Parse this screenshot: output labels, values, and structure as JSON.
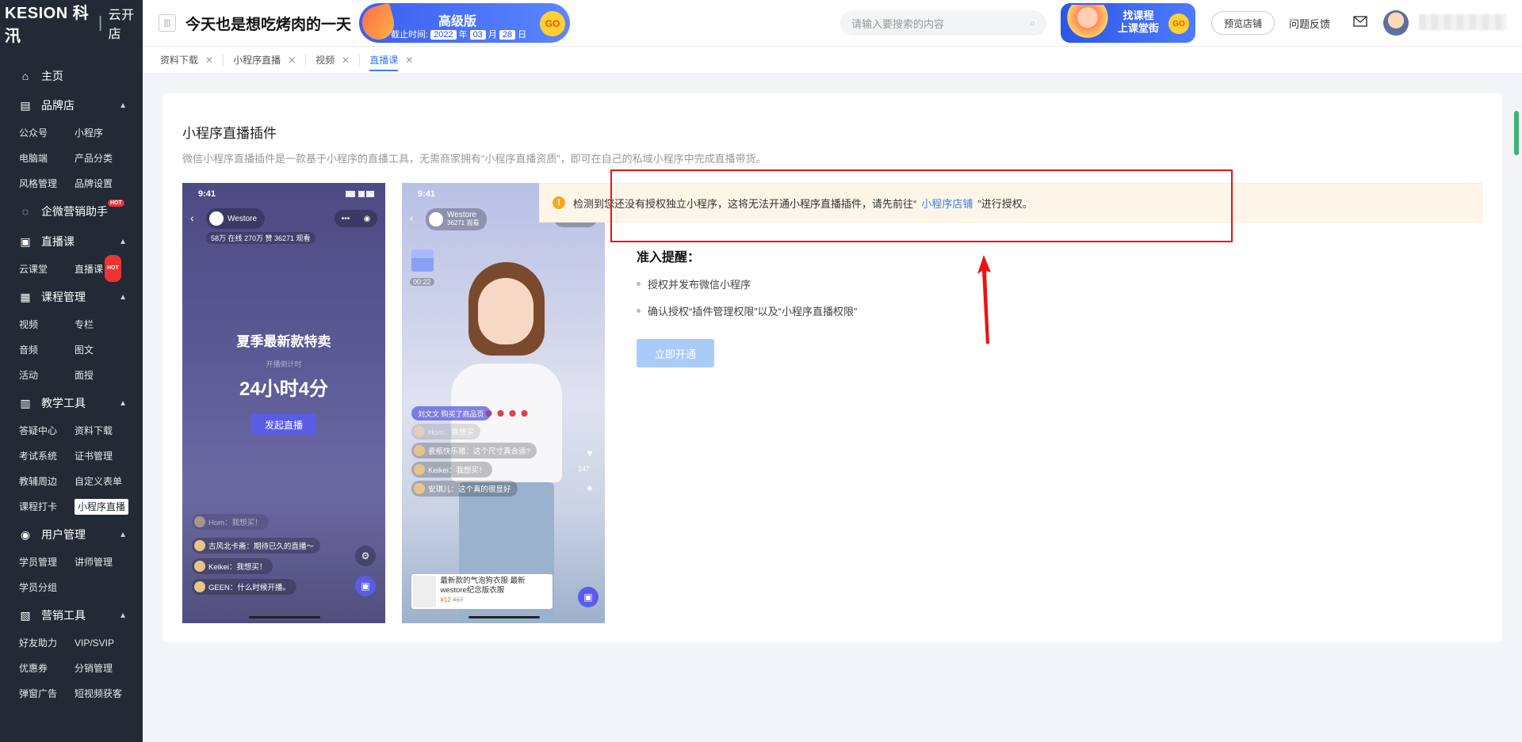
{
  "sidebar": {
    "logo_brand": "KESION 科汛",
    "logo_sub": "云开店",
    "home": "主页",
    "groups": [
      {
        "label": "品牌店",
        "items": [
          "公众号",
          "小程序",
          "电脑端",
          "产品分类",
          "风格管理",
          "品牌设置"
        ]
      },
      {
        "label": "企微营销助手",
        "items": [],
        "hot": "HOT"
      },
      {
        "label": "直播课",
        "items": [
          "云课堂",
          "直播课"
        ],
        "item_hot": "HOT"
      },
      {
        "label": "课程管理",
        "items": [
          "视频",
          "专栏",
          "音频",
          "图文",
          "活动",
          "面授"
        ]
      },
      {
        "label": "教学工具",
        "items": [
          "答疑中心",
          "资料下载",
          "考试系统",
          "证书管理",
          "教辅周边",
          "自定义表单",
          "课程打卡",
          "小程序直播"
        ]
      },
      {
        "label": "用户管理",
        "items": [
          "学员管理",
          "讲师管理",
          "学员分组"
        ]
      },
      {
        "label": "营销工具",
        "items": [
          "好友助力",
          "VIP/SVIP",
          "优惠券",
          "分销管理",
          "弹窗广告",
          "短视频获客"
        ]
      }
    ]
  },
  "header": {
    "title": "今天也是想吃烤肉的一天",
    "promo": {
      "title": "高级版",
      "date_label": "截止时间:",
      "year": "2022",
      "year_unit": "年",
      "month": "03",
      "month_unit": "月",
      "day": "28",
      "day_unit": "日",
      "go": "GO"
    },
    "search_placeholder": "请输入要搜索的内容",
    "banner2_line1": "找课程",
    "banner2_line2": "上课堂街",
    "banner2_go": "GO",
    "preview_store": "预览店铺",
    "feedback": "问题反馈"
  },
  "tabs": [
    {
      "label": "资料下载",
      "active": false
    },
    {
      "label": "小程序直播",
      "active": false
    },
    {
      "label": "视频",
      "active": false
    },
    {
      "label": "直播课",
      "active": true
    }
  ],
  "main": {
    "title": "小程序直播插件",
    "desc": "微信小程序直播插件是一款基于小程序的直播工具，无需商家拥有“小程序直播资质”，即可在自己的私域小程序中完成直播带货。",
    "alert": {
      "pre": "检测到您还没有授权独立小程序，这将无法开通小程序直播插件，请先前往“",
      "link": "小程序店铺",
      "post": "”进行授权。"
    },
    "requirements_title": "准入提醒：",
    "requirements": [
      "授权并发布微信小程序",
      "确认授权“插件管理权限”以及“小程序直播权限”"
    ],
    "open_button": "立即开通"
  },
  "phone1": {
    "time": "9:41",
    "store": "Westore",
    "stats": "58万 在线  270万 赞  36271 观看",
    "headline": "夏季最新款特卖",
    "countdown_label": "开播倒计时",
    "countdown": "24小时4分",
    "start_button": "发起直播",
    "comments": [
      "Hom：我想买！",
      "古风北卡斋：期待已久的直播～",
      "Keikei：我想买！",
      "GEEN：什么时候开播。"
    ]
  },
  "phone2": {
    "time": "9:41",
    "store": "Westore",
    "store_sub": "36271 观看",
    "gift_time": "00:22",
    "tag": "刘文文 购买了商品页",
    "comments": [
      "Hom：我想买",
      "瓷瓶快乐猪：这个尺寸真合适?",
      "Keikei：我想买！",
      "安琪儿：这个真的很显好"
    ],
    "likes": "247",
    "product_title": "最新款的气泡狗衣服 最新westore纪念版衣服",
    "product_price": "¥12",
    "product_old_price": "¥17"
  },
  "colors": {
    "sidebar_bg": "#232a36",
    "accent": "#3d7bf0",
    "alert_bg": "#fdf6e8",
    "warn": "#f5a623",
    "annotation": "#ee1111"
  }
}
